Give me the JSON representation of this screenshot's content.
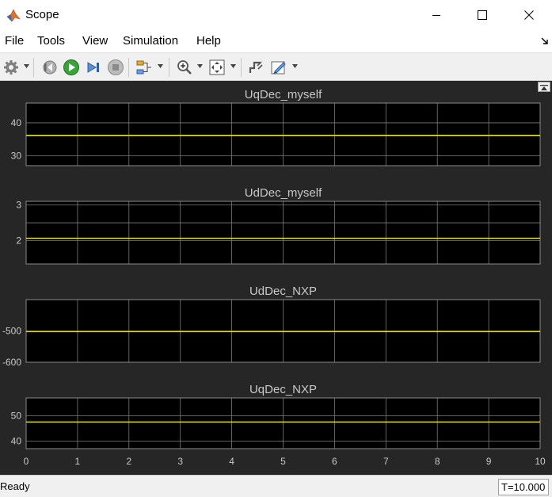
{
  "window": {
    "title": "Scope"
  },
  "menu": {
    "file": "File",
    "tools": "Tools",
    "view": "View",
    "simulation": "Simulation",
    "help": "Help"
  },
  "colors": {
    "plot_bg": "#000000",
    "figure_bg": "#262626",
    "grid": "#7a7a7a",
    "trace": "#ffff00",
    "text": "#c8c8c8"
  },
  "chart_data": [
    {
      "type": "line",
      "title": "UqDec_myself",
      "xlim": [
        0,
        10
      ],
      "ylim": [
        27,
        46
      ],
      "yticks": [
        30,
        40
      ],
      "ygrid": [
        30,
        36,
        40
      ],
      "series": [
        {
          "x": [
            0,
            10
          ],
          "y": [
            36.2,
            36.2
          ]
        }
      ]
    },
    {
      "type": "line",
      "title": "UdDec_myself",
      "xlim": [
        0,
        10
      ],
      "ylim": [
        1.35,
        3.1
      ],
      "yticks": [
        2,
        3
      ],
      "ygrid": [
        2,
        2.5,
        3
      ],
      "series": [
        {
          "x": [
            0,
            10
          ],
          "y": [
            2.07,
            2.07
          ]
        }
      ]
    },
    {
      "type": "line",
      "title": "UdDec_NXP",
      "xlim": [
        0,
        10
      ],
      "ylim": [
        -600,
        -400
      ],
      "yticks": [
        -600,
        -500
      ],
      "ygrid": [
        -600,
        -500
      ],
      "series": [
        {
          "x": [
            0,
            10
          ],
          "y": [
            -502,
            -502
          ]
        }
      ]
    },
    {
      "type": "line",
      "title": "UqDec_NXP",
      "xlim": [
        0,
        10
      ],
      "ylim": [
        37,
        57
      ],
      "yticks": [
        40,
        50
      ],
      "ygrid": [
        40,
        50
      ],
      "series": [
        {
          "x": [
            0,
            10
          ],
          "y": [
            47.5,
            47.5
          ]
        }
      ],
      "xticks": [
        0,
        1,
        2,
        3,
        4,
        5,
        6,
        7,
        8,
        9,
        10
      ]
    }
  ],
  "status": {
    "text": "Ready",
    "time": "T=10.000"
  }
}
